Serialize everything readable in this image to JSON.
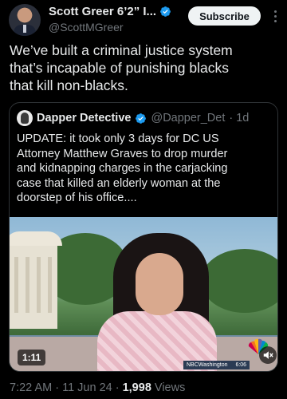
{
  "author": {
    "display_name": "Scott Greer 6’2” I...",
    "handle": "@ScottMGreer",
    "verified_icon": "verified-badge-icon"
  },
  "actions": {
    "subscribe_label": "Subscribe",
    "more_icon": "more-options-icon"
  },
  "tweet": {
    "text": "We’ve built a criminal justice system\nthat’s incapable of punishing blacks\nthat kill non-blacks."
  },
  "quoted": {
    "display_name": "Dapper Detective",
    "handle": "@Dapper_Det",
    "time": "· 1d",
    "text": "UPDATE: it took only 3 days for DC US\nAttorney Matthew Graves to drop murder\nand kidnapping charges in the carjacking\ncase that killed an elderly woman at the\ndoorstep of his office....",
    "video": {
      "duration": "1:11",
      "ticker_source": "NBCWashington",
      "ticker_time": "6:06",
      "speaker_icon": "muted-speaker-icon"
    }
  },
  "meta": {
    "time": "7:22 AM · 11 Jun 24 · ",
    "views_count": "1,998",
    "views_label": " Views"
  },
  "colors": {
    "background": "#000000",
    "text_primary": "#e7e9ea",
    "text_secondary": "#71767b",
    "verified_blue": "#1d9bf0",
    "border": "#2f3336"
  }
}
